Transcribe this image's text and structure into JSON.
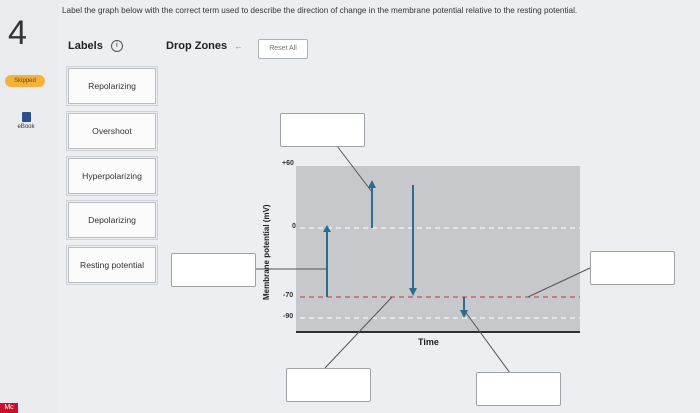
{
  "question": {
    "number": "4",
    "prompt": "Label the graph below with the correct term used to describe the direction of change in the membrane potential relative to the resting potential."
  },
  "sidebar": {
    "skipped_label": "Skipped",
    "ebook_label": "eBook",
    "brand": "Mc"
  },
  "labels_panel": {
    "heading": "Labels",
    "info_glyph": "i",
    "items": [
      "Repolarizing",
      "Overshoot",
      "Hyperpolarizing",
      "Depolarizing",
      "Resting potential"
    ]
  },
  "drop_zones": {
    "heading": "Drop Zones",
    "arrow": "←",
    "reset_label": "Reset All"
  },
  "graph": {
    "y_axis_label": "Membrane potential (mV)",
    "x_axis_label": "Time",
    "y_ticks": [
      "+60",
      "0",
      "-70",
      "-90"
    ],
    "colors": {
      "arrow": "#2a6f8f",
      "threshold_line": "#c0392b",
      "plot_bg": "#c6c8cc",
      "baseline": "#2e2e2e"
    }
  }
}
